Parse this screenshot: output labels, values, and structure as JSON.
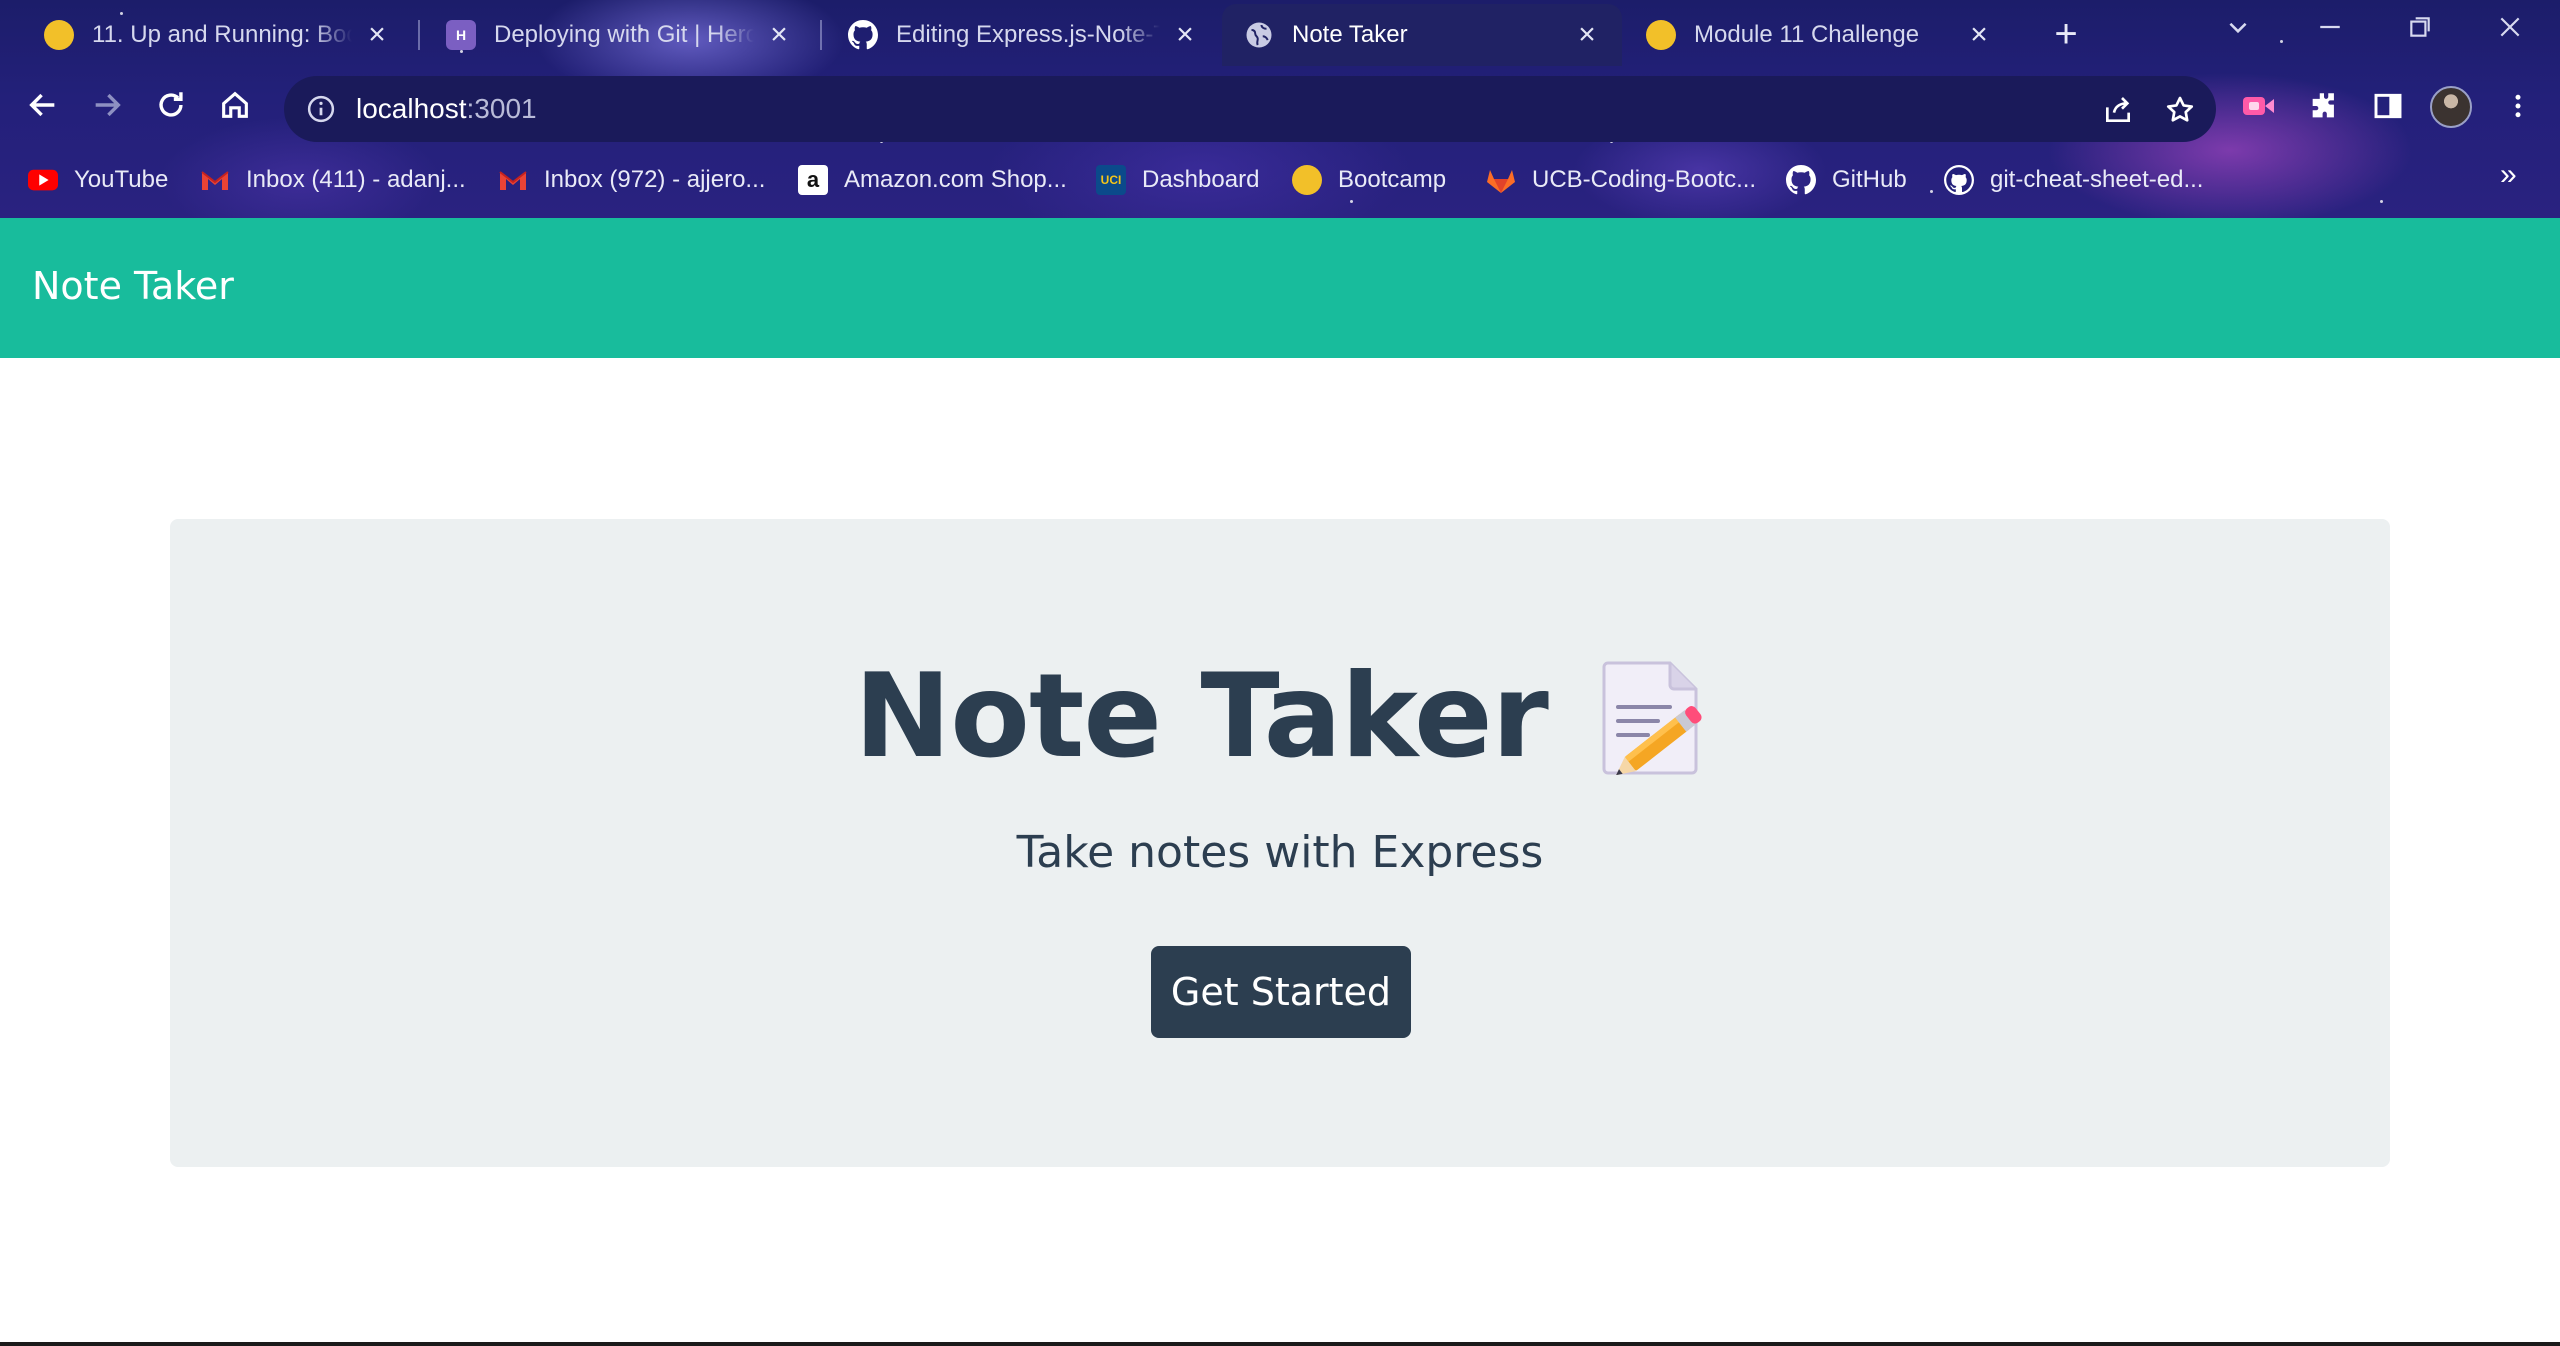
{
  "browser": {
    "tabs": [
      {
        "title": "11. Up and Running: Boot",
        "favicon": "bootcamp-icon"
      },
      {
        "title": "Deploying with Git | Herok",
        "favicon": "heroku-icon"
      },
      {
        "title": "Editing Express.js-Note-Ta",
        "favicon": "github-icon"
      },
      {
        "title": "Note Taker",
        "favicon": "globe-icon",
        "active": true
      },
      {
        "title": "Module 11 Challenge",
        "favicon": "bootcamp-icon"
      }
    ],
    "address": {
      "host": "localhost",
      "port": ":3001"
    },
    "bookmarks": [
      {
        "label": "YouTube",
        "icon": "youtube-icon"
      },
      {
        "label": "Inbox (411) - adanj...",
        "icon": "gmail-icon"
      },
      {
        "label": "Inbox (972) - ajjero...",
        "icon": "gmail-icon"
      },
      {
        "label": "Amazon.com Shop...",
        "icon": "amazon-icon"
      },
      {
        "label": "Dashboard",
        "icon": "uci-icon"
      },
      {
        "label": "Bootcamp",
        "icon": "bootcamp-icon"
      },
      {
        "label": "UCB-Coding-Bootc...",
        "icon": "gitlab-icon"
      },
      {
        "label": "GitHub",
        "icon": "github-icon"
      },
      {
        "label": "git-cheat-sheet-ed...",
        "icon": "github-icon"
      }
    ],
    "uci_badge": "UCI",
    "amazon_badge": "a",
    "heroku_badge": "H",
    "colors": {
      "chrome_bg": "#23207a",
      "active_tab": "#202264",
      "omnibox": "#1a1a5a"
    }
  },
  "page": {
    "brand": "Note Taker",
    "hero": {
      "title": "Note Taker",
      "subtitle": "Take notes with Express",
      "button": "Get Started"
    },
    "colors": {
      "navbar": "#18bc9c",
      "jumbotron": "#ecf0f1",
      "text": "#2c3e50",
      "button": "#2c3e50"
    }
  }
}
